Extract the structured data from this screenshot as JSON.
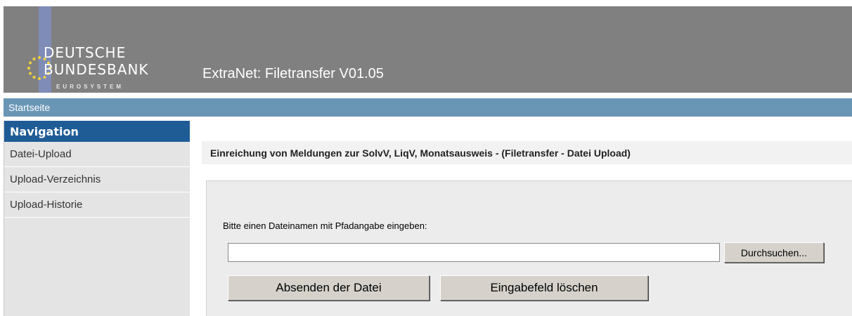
{
  "brand": {
    "line1": "DEUTSCHE",
    "line2": "BUNDESBANK",
    "sub": "EUROSYSTEM",
    "star_color": "#f2d23a",
    "bar_color": "#7f8cb7"
  },
  "header": {
    "title": "ExtraNet: Filetransfer V01.05",
    "background": "#808080"
  },
  "topnav": {
    "home_label": "Startseite",
    "background": "#6a96b6"
  },
  "sidebar": {
    "heading": "Navigation",
    "heading_color": "#1f5c96",
    "items": [
      {
        "label": "Datei-Upload"
      },
      {
        "label": "Upload-Verzeichnis"
      },
      {
        "label": "Upload-Historie"
      }
    ]
  },
  "main": {
    "title": "Einreichung von Meldungen zur SolvV, LiqV, Monatsausweis - (Filetransfer - Datei Upload)",
    "prompt": "Bitte einen Dateinamen mit Pfadangabe eingeben:",
    "file_value": "",
    "browse_label": "Durchsuchen...",
    "submit_label": "Absenden der Datei",
    "clear_label": "Eingabefeld löschen"
  }
}
